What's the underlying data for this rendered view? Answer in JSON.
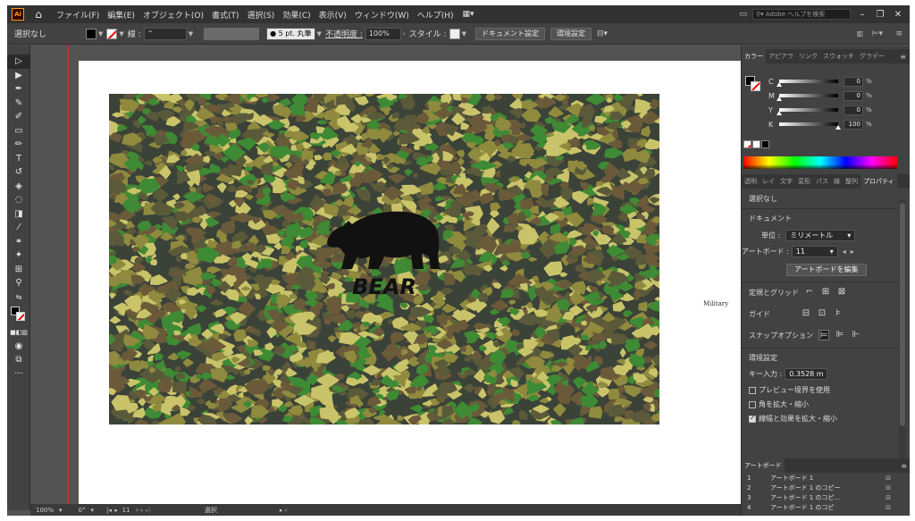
{
  "app": {
    "logo": "Ai",
    "workspace_icon": "workspace-switcher-icon"
  },
  "menu": {
    "items": [
      "ファイル(F)",
      "編集(E)",
      "オブジェクト(O)",
      "書式(T)",
      "選択(S)",
      "効果(C)",
      "表示(V)",
      "ウィンドウ(W)",
      "ヘルプ(H)"
    ],
    "search_placeholder": "Adobe ヘルプを検索"
  },
  "control": {
    "selection": "選択なし",
    "stroke_label": "線 :",
    "brush": "5 pt. 丸筆",
    "opacity_label": "不透明度 :",
    "opacity_value": "100%",
    "style_label": "スタイル :",
    "doc_setup": "ドキュメント設定",
    "prefs": "環境設定"
  },
  "canvas": {
    "bear_text": "BEAR",
    "side_text": "Military"
  },
  "status": {
    "zoom": "100%",
    "rotation": "0°",
    "artboard": "11",
    "mode": "選択"
  },
  "color_panel": {
    "tabs": [
      "カラー",
      "アピアラ",
      "リンク",
      "スウォッチ",
      "グラデー"
    ],
    "sliders": [
      {
        "label": "C",
        "value": "0",
        "unit": "%",
        "level": 0
      },
      {
        "label": "M",
        "value": "0",
        "unit": "%",
        "level": 0
      },
      {
        "label": "Y",
        "value": "0",
        "unit": "%",
        "level": 0
      },
      {
        "label": "K",
        "value": "100",
        "unit": "%",
        "level": 1
      }
    ]
  },
  "props_panel": {
    "tabs": [
      "透明",
      "レイ",
      "文字",
      "変形",
      "パス",
      "線",
      "整列",
      "プロパティ"
    ],
    "no_selection": "選択なし",
    "document": "ドキュメント",
    "unit_label": "単位 :",
    "unit_value": "ミリメートル",
    "artboard_label": "アートボード :",
    "artboard_value": "11",
    "edit_artboard": "アートボードを編集",
    "rulers_grid": "定規とグリッド",
    "guides": "ガイド",
    "snap": "スナップオプション",
    "prefs_title": "環境設定",
    "key_input_label": "キー入力 :",
    "key_input_value": "0.3528 m",
    "chk_preview": "プレビュー境界を使用",
    "chk_corners": "角を拡大・縮小",
    "chk_strokes": "線幅と効果を拡大・縮小"
  },
  "artboard_panel": {
    "title": "アートボード",
    "rows": [
      {
        "n": "1",
        "name": "アートボード 1"
      },
      {
        "n": "2",
        "name": "アートボード 1 のコピー"
      },
      {
        "n": "3",
        "name": "アートボード 1 のコピ..."
      },
      {
        "n": "4",
        "name": "アートボード 1 のコピ"
      }
    ]
  },
  "camo_colors": [
    "#3b4238",
    "#5a5a3a",
    "#8f8a3e",
    "#c9c46a",
    "#3f8a34",
    "#6b5a3a"
  ]
}
